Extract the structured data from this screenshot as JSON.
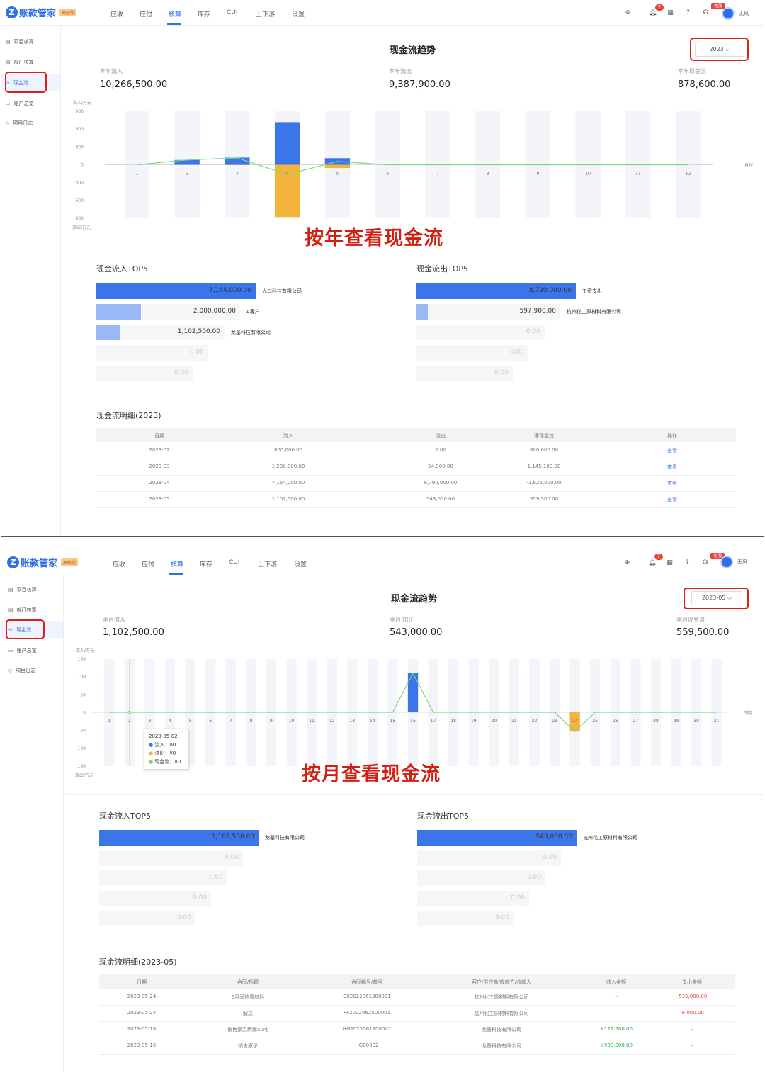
{
  "app": {
    "logo_text": "账款管家",
    "edition": "高级版",
    "nav": [
      "应收",
      "应付",
      "核算",
      "库存",
      "CUI",
      "上下游",
      "设置"
    ],
    "active_nav": "核算",
    "notif_count": "7",
    "service_badge": "客服",
    "user": "无风"
  },
  "sidebar": [
    "项目核算",
    "部门核算",
    "现金流",
    "账户总览",
    "项目日志"
  ],
  "s1": {
    "title": "现金流趋势",
    "year": "2023",
    "stats": [
      {
        "label": "本年流入",
        "value": "10,266,500.00"
      },
      {
        "label": "本年流出",
        "value": "9,387,900.00"
      },
      {
        "label": "本年现金流",
        "value": "878,600.00"
      }
    ],
    "caption": "按年查看现金流",
    "top_in_title": "现金流入TOP5",
    "top_out_title": "现金流出TOP5",
    "top_in": [
      {
        "value": "7,164,000.00",
        "name": "光口科技有限公司",
        "ratio": 1
      },
      {
        "value": "2,000,000.00",
        "name": "A客户",
        "ratio": 0.28
      },
      {
        "value": "1,102,500.00",
        "name": "龙基科技有限公司",
        "ratio": 0.15
      },
      {
        "value": "0.00",
        "name": "",
        "ratio": 0
      },
      {
        "value": "0.00",
        "name": "",
        "ratio": 0
      }
    ],
    "top_out": [
      {
        "value": "8,790,000.00",
        "name": "工资支出",
        "ratio": 1
      },
      {
        "value": "597,900.00",
        "name": "杭州化工原材料有限公司",
        "ratio": 0.07
      },
      {
        "value": "0.00",
        "name": "",
        "ratio": 0
      },
      {
        "value": "0.00",
        "name": "",
        "ratio": 0
      },
      {
        "value": "0.00",
        "name": "",
        "ratio": 0
      }
    ],
    "detail_title": "现金流明细(2023)",
    "detail_headers": [
      "日期",
      "流入",
      "流出",
      "净现金流",
      "操作"
    ],
    "detail_rows": [
      [
        "2023-02",
        "800,000.00",
        "0.00",
        "800,000.00",
        "查看"
      ],
      [
        "2023-03",
        "1,200,000.00",
        "54,900.00",
        "1,145,100.00",
        "查看"
      ],
      [
        "2023-04",
        "7,164,000.00",
        "8,790,000.00",
        "-1,626,000.00",
        "查看"
      ],
      [
        "2023-05",
        "1,102,500.00",
        "543,000.00",
        "559,500.00",
        "查看"
      ]
    ]
  },
  "s2": {
    "title": "现金流趋势",
    "month": "2023-05",
    "stats": [
      {
        "label": "本月流入",
        "value": "1,102,500.00"
      },
      {
        "label": "本月流出",
        "value": "543,000.00"
      },
      {
        "label": "本月现金流",
        "value": "559,500.00"
      }
    ],
    "caption": "按月查看现金流",
    "tooltip": {
      "date": "2023-05-02",
      "inflow": "流入：¥0",
      "outflow": "流出：¥0",
      "net": "现金流：¥0"
    },
    "top_in_title": "现金流入TOP5",
    "top_out_title": "现金流出TOP5",
    "top_in": [
      {
        "value": "1,102,500.00",
        "name": "龙基科技有限公司",
        "ratio": 1
      },
      {
        "value": "0.00",
        "name": "",
        "ratio": 0
      },
      {
        "value": "0.00",
        "name": "",
        "ratio": 0
      },
      {
        "value": "0.00",
        "name": "",
        "ratio": 0
      },
      {
        "value": "0.00",
        "name": "",
        "ratio": 0
      }
    ],
    "top_out": [
      {
        "value": "543,000.00",
        "name": "杭州化工原材料有限公司",
        "ratio": 1
      },
      {
        "value": "0.00",
        "name": "",
        "ratio": 0
      },
      {
        "value": "0.00",
        "name": "",
        "ratio": 0
      },
      {
        "value": "0.00",
        "name": "",
        "ratio": 0
      },
      {
        "value": "0.00",
        "name": "",
        "ratio": 0
      }
    ],
    "detail_title": "现金流明细(2023-05)",
    "detail_headers": [
      "日期",
      "合同/标题",
      "合同编号/单号",
      "客户/供应商/收款方/收款人",
      "收入金额",
      "支出金额"
    ],
    "detail_rows": [
      [
        "2023-05-24",
        "6月采购原材料",
        "CX2022061300001",
        "杭州化工原材料有限公司",
        "–",
        "-535,000.00"
      ],
      [
        "2023-05-24",
        "解决",
        "PF2022062500001",
        "杭州化工原材料有限公司",
        "–",
        "-8,000.00"
      ],
      [
        "2023-05-18",
        "销售聚乙丙烯50吨",
        "HG2022061200001",
        "龙基科技有限公司",
        "+122,500.00",
        "–"
      ],
      [
        "2023-05-16",
        "销售原子",
        "HG00002",
        "龙基科技有限公司",
        "+980,000.00",
        "–"
      ]
    ]
  },
  "chart_data": [
    {
      "type": "bar",
      "title": "现金流趋势",
      "x_unit": "月份",
      "y_top_label": "流入/万元",
      "y_bottom_label": "流出/万元",
      "ylim": [
        -900,
        900
      ],
      "yticks": [
        "900",
        "600",
        "300",
        "0",
        "300",
        "600",
        "900"
      ],
      "categories": [
        "1",
        "2",
        "3",
        "4",
        "5",
        "6",
        "7",
        "8",
        "9",
        "10",
        "11",
        "12"
      ],
      "series": [
        {
          "name": "流入",
          "values": [
            0,
            80,
            120,
            716.4,
            110.25,
            0,
            0,
            0,
            0,
            0,
            0,
            0
          ]
        },
        {
          "name": "流出",
          "values": [
            0,
            0,
            5.49,
            879,
            54.3,
            0,
            0,
            0,
            0,
            0,
            0,
            0
          ]
        },
        {
          "name": "现金流",
          "values": [
            0,
            80,
            114.5,
            -162.6,
            55.95,
            0,
            0,
            0,
            0,
            0,
            0,
            0
          ]
        }
      ],
      "colors": {
        "inflow": "#3a76ea",
        "outflow": "#f2b43a",
        "net": "#7ed67e"
      }
    },
    {
      "type": "bar",
      "title": "现金流趋势",
      "x_unit": "日期",
      "y_top_label": "流入/万元",
      "y_bottom_label": "流出/万元",
      "ylim": [
        -150,
        150
      ],
      "yticks": [
        "150",
        "100",
        "50",
        "0",
        "50",
        "100",
        "150"
      ],
      "categories": [
        "1",
        "2",
        "3",
        "4",
        "5",
        "6",
        "7",
        "8",
        "9",
        "10",
        "11",
        "12",
        "13",
        "14",
        "15",
        "16",
        "17",
        "18",
        "19",
        "20",
        "21",
        "22",
        "23",
        "24",
        "25",
        "26",
        "27",
        "28",
        "29",
        "30",
        "31"
      ],
      "series": [
        {
          "name": "流入",
          "values": [
            0,
            0,
            0,
            0,
            0,
            0,
            0,
            0,
            0,
            0,
            0,
            0,
            0,
            0,
            0,
            110.25,
            0,
            0,
            0,
            0,
            0,
            0,
            0,
            0,
            0,
            0,
            0,
            0,
            0,
            0,
            0
          ]
        },
        {
          "name": "流出",
          "values": [
            0,
            0,
            0,
            0,
            0,
            0,
            0,
            0,
            0,
            0,
            0,
            0,
            0,
            0,
            0,
            0,
            0,
            0,
            0,
            0,
            0,
            0,
            0,
            54.3,
            0,
            0,
            0,
            0,
            0,
            0,
            0
          ]
        },
        {
          "name": "现金流",
          "values": [
            0,
            0,
            0,
            0,
            0,
            0,
            0,
            0,
            0,
            0,
            0,
            0,
            0,
            0,
            0,
            110.25,
            0,
            0,
            0,
            0,
            0,
            0,
            0,
            -54.3,
            0,
            0,
            0,
            0,
            0,
            0,
            0
          ]
        }
      ],
      "colors": {
        "inflow": "#3a76ea",
        "outflow": "#f2b43a",
        "net": "#7ed67e"
      }
    }
  ]
}
